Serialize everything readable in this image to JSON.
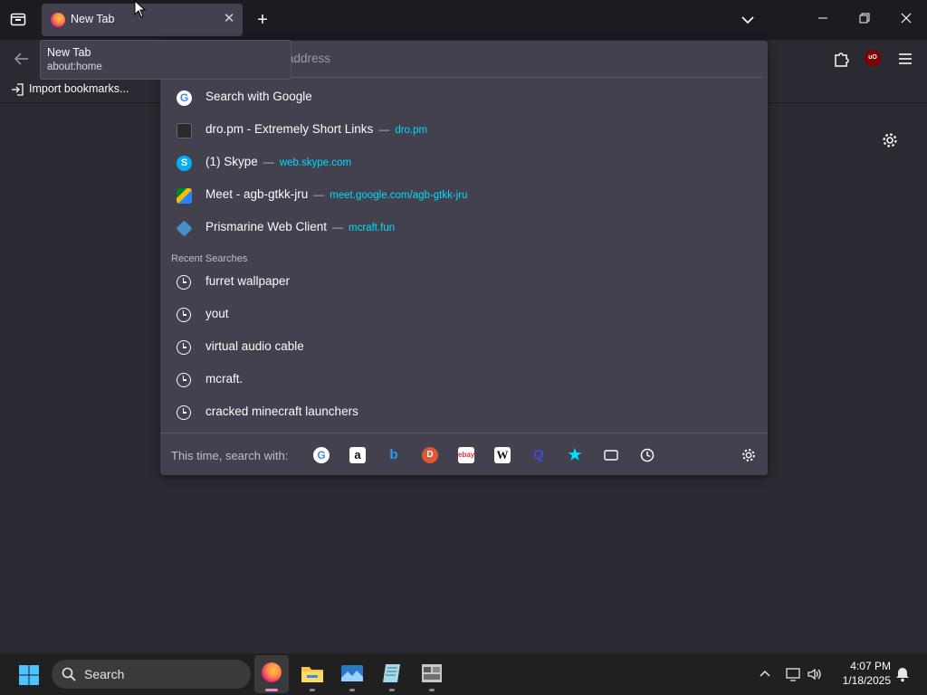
{
  "browser": {
    "tab": {
      "title": "New Tab"
    },
    "tooltip": {
      "title": "New Tab",
      "url": "about:home"
    },
    "bookmarks": {
      "import_label": "Import bookmarks..."
    },
    "urlbar": {
      "placeholder": "address"
    },
    "suggestions": [
      {
        "label": "Search with Google",
        "url": "",
        "icon": "google-icon"
      },
      {
        "label": "dro.pm - Extremely Short Links",
        "url": "dro.pm",
        "icon": "dropm-favicon"
      },
      {
        "label": "(1) Skype",
        "url": "web.skype.com",
        "icon": "skype-icon"
      },
      {
        "label": "Meet - agb-gtkk-jru",
        "url": "meet.google.com/agb-gtkk-jru",
        "icon": "meet-icon"
      },
      {
        "label": "Prismarine Web Client",
        "url": "mcraft.fun",
        "icon": "prismarine-icon"
      }
    ],
    "recent_header": "Recent Searches",
    "recent": [
      "furret wallpaper",
      "yout",
      "virtual audio cable",
      "mcraft.",
      "cracked minecraft launchers"
    ],
    "search_with_label": "This time, search with:",
    "engines": [
      "google",
      "amazon",
      "bing",
      "duckduckgo",
      "ebay",
      "wikipedia",
      "perplexity",
      "bookmarks",
      "tabs",
      "history"
    ]
  },
  "taskbar": {
    "search_label": "Search",
    "time": "4:07 PM",
    "date": "1/18/2025"
  },
  "colors": {
    "accent_link": "#00ddff",
    "panel": "#42414d",
    "toolbar": "#2b2a33",
    "tabstrip": "#1c1b22"
  }
}
